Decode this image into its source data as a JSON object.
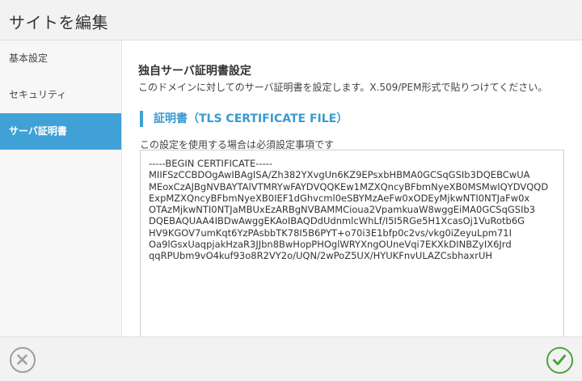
{
  "header": {
    "title": "サイトを編集"
  },
  "sidebar": {
    "items": [
      {
        "label": "基本設定"
      },
      {
        "label": "セキュリティ"
      },
      {
        "label": "サーバ証明書"
      }
    ]
  },
  "main": {
    "section_title": "独自サーバ証明書設定",
    "section_desc": "このドメインに対してのサーバ証明書を設定します。X.509/PEM形式で貼りつけてください。",
    "subheading": "証明書（TLS CERTIFICATE FILE）",
    "field_note": "この設定を使用する場合は必須設定事項です",
    "certificate_value": "-----BEGIN CERTIFICATE-----\nMIIFSzCCBDOgAwIBAgISA/Zh382YXvgUn6KZ9EPsxbHBMA0GCSqGSIb3DQEBCwUA\nMEoxCzAJBgNVBAYTAlVTMRYwFAYDVQQKEw1MZXQncyBFbmNyeXB0MSMwIQYDVQQD\nExpMZXQncyBFbmNyeXB0IEF1dGhvcml0eSBYMzAeFw0xODEyMjkwNTI0NTJaFw0x\nOTAzMjkwNTI0NTJaMBUxEzARBgNVBAMMCioua2VpamkuaW8wggEiMA0GCSqGSIb3\nDQEBAQUAA4IBDwAwggEKAoIBAQDdUdnmlcWhLf/I5I5RGe5H1XcasOj1VuRotb6G\nHV9KGOV7umKqt6YzPAsbbTK78I5B6PYT+o70i3E1bfp0c2vs/vkg0iZeyuLpm71I\nOa9lGsxUaqpjakHzaR3JJbn8BwHopPHOglWRYXngOUneVqi7EKXkDINBZyIX6Jrd\nqqRPUbm9vO4kuf93o8R2VY2o/UQN/2wPoZ5UX/HYUKFnvULAZCsbhaxrUH"
  },
  "footer": {
    "cancel_icon": "close-circle-icon",
    "ok_icon": "check-circle-icon"
  },
  "colors": {
    "accent": "#3fa1d6",
    "ok": "#4aa43a",
    "cancel": "#9e9e9e"
  }
}
